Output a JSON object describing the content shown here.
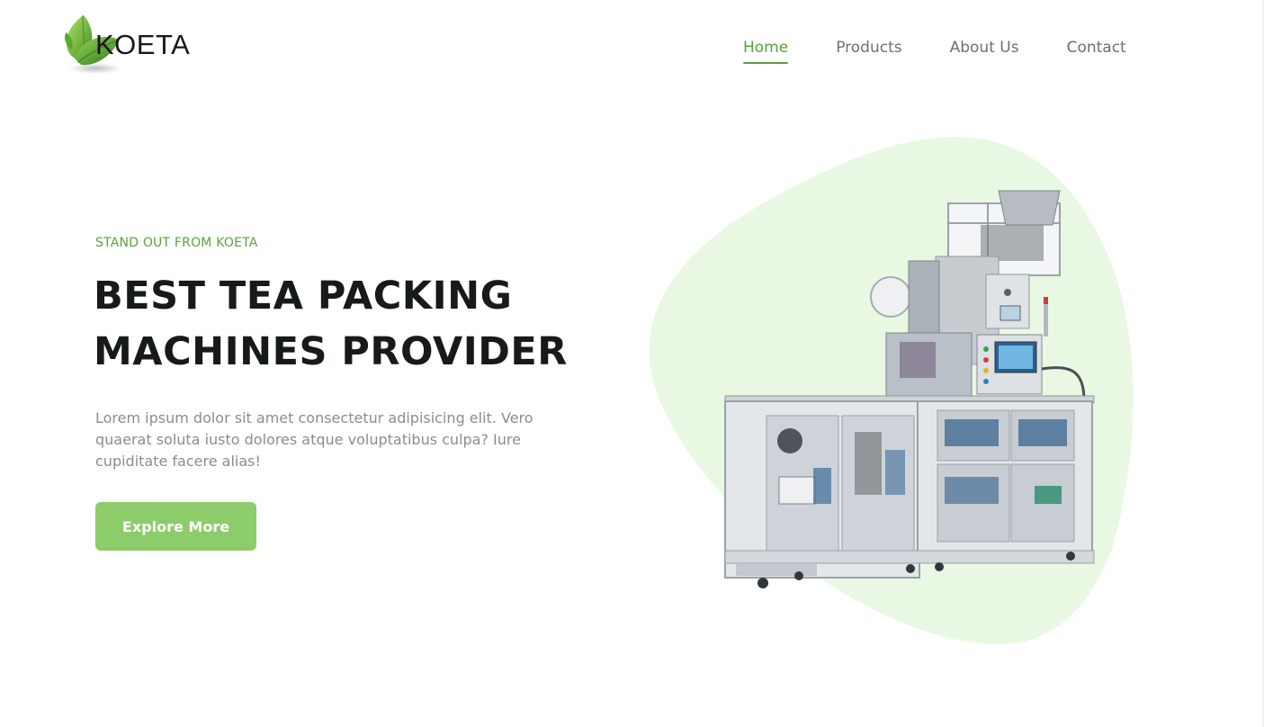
{
  "header": {
    "brand": "KOETA",
    "nav": [
      {
        "label": "Home",
        "active": true
      },
      {
        "label": "Products",
        "active": false
      },
      {
        "label": "About Us",
        "active": false
      },
      {
        "label": "Contact",
        "active": false
      }
    ]
  },
  "hero": {
    "kicker": "STAND OUT FROM KOETA",
    "headline_line1": "BEST TEA PACKING",
    "headline_line2": "MACHINES PROVIDER",
    "description": "Lorem ipsum dolor sit amet consectetur adipisicing elit. Vero quaerat soluta iusto dolores atque voluptatibus culpa? Iure cupiditate facere alias!",
    "cta_label": "Explore More",
    "image_subject": "tea-packing-machine"
  },
  "colors": {
    "accent": "#5ea13b",
    "button": "#8ccc6b",
    "blob": "#e9f8e2",
    "heading": "#161a1b",
    "body_text": "#8c8c8c",
    "nav_text": "#6f6f6f"
  },
  "icons": {
    "logo": "tea-leaves-icon"
  }
}
